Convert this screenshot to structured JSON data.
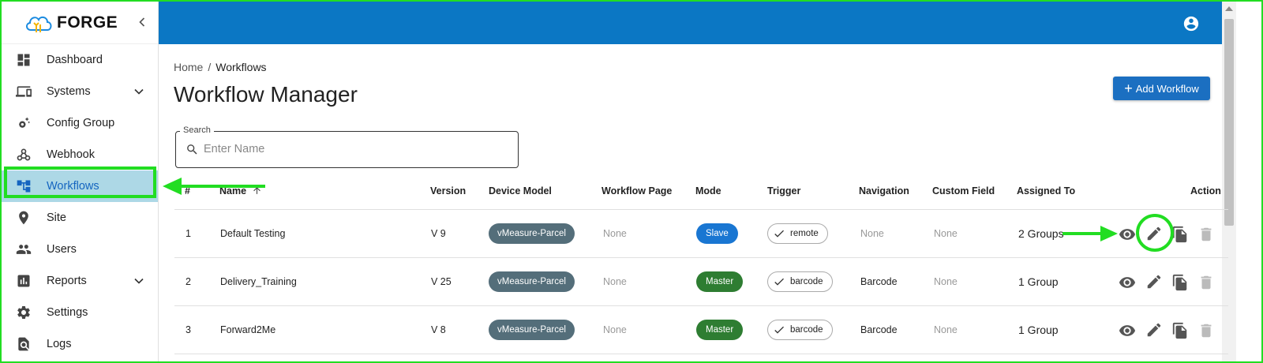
{
  "app": {
    "name": "FORGE"
  },
  "sidebar": {
    "items": [
      {
        "label": "Dashboard",
        "icon": "dashboard-icon",
        "expandable": false
      },
      {
        "label": "Systems",
        "icon": "devices-icon",
        "expandable": true
      },
      {
        "label": "Config Group",
        "icon": "settings-suggest-icon",
        "expandable": false
      },
      {
        "label": "Webhook",
        "icon": "webhook-icon",
        "expandable": false
      },
      {
        "label": "Workflows",
        "icon": "account-tree-icon",
        "expandable": false,
        "active": true
      },
      {
        "label": "Site",
        "icon": "location-pin-icon",
        "expandable": false
      },
      {
        "label": "Users",
        "icon": "people-icon",
        "expandable": false
      },
      {
        "label": "Reports",
        "icon": "assessment-icon",
        "expandable": true
      },
      {
        "label": "Settings",
        "icon": "gear-icon",
        "expandable": false
      },
      {
        "label": "Logs",
        "icon": "find-in-page-icon",
        "expandable": false
      }
    ]
  },
  "breadcrumb": {
    "home": "Home",
    "separator": "/",
    "current": "Workflows"
  },
  "page": {
    "title": "Workflow Manager",
    "add_button": "Add Workflow"
  },
  "search": {
    "label": "Search",
    "placeholder": "Enter Name"
  },
  "table": {
    "headers": {
      "index": "#",
      "name": "Name",
      "version": "Version",
      "device_model": "Device Model",
      "workflow_page": "Workflow Page",
      "mode": "Mode",
      "trigger": "Trigger",
      "navigation": "Navigation",
      "custom_field": "Custom Field",
      "assigned_to": "Assigned To",
      "action": "Action"
    },
    "sort": {
      "column": "name",
      "direction": "ascending"
    },
    "rows": [
      {
        "index": "1",
        "name": "Default Testing",
        "version": "V 9",
        "device_model": "vMeasure-Parcel",
        "workflow_page": "None",
        "mode": "Slave",
        "trigger": "remote",
        "navigation": "None",
        "custom_field": "None",
        "assigned_to": "2 Groups"
      },
      {
        "index": "2",
        "name": "Delivery_Training",
        "version": "V 25",
        "device_model": "vMeasure-Parcel",
        "workflow_page": "None",
        "mode": "Master",
        "trigger": "barcode",
        "navigation": "Barcode",
        "custom_field": "None",
        "assigned_to": "1 Group"
      },
      {
        "index": "3",
        "name": "Forward2Me",
        "version": "V 8",
        "device_model": "vMeasure-Parcel",
        "workflow_page": "None",
        "mode": "Master",
        "trigger": "barcode",
        "navigation": "Barcode",
        "custom_field": "None",
        "assigned_to": "1 Group"
      }
    ]
  },
  "colors": {
    "header_bar": "#0b77c4",
    "active_nav": "#add8e6",
    "annotation": "#22dd22",
    "mode_slave": "#1976d2",
    "mode_master": "#2e7d32",
    "device_chip": "#546e7a"
  }
}
